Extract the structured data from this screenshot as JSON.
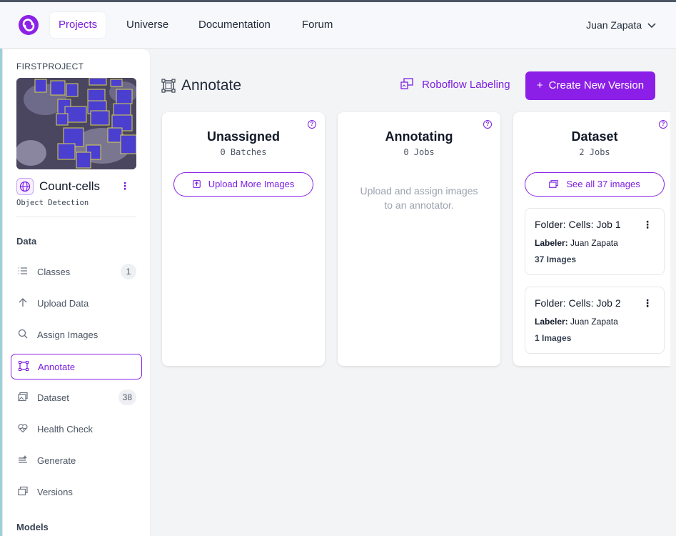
{
  "nav": {
    "items": [
      {
        "label": "Projects",
        "active": true
      },
      {
        "label": "Universe"
      },
      {
        "label": "Documentation"
      },
      {
        "label": "Forum"
      }
    ],
    "user": "Juan Zapata"
  },
  "sidebar": {
    "workspace": "FIRSTPROJECT",
    "project_name": "Count-cells",
    "project_type": "Object Detection",
    "sections": {
      "data": "Data",
      "models": "Models"
    },
    "items": [
      {
        "label": "Classes",
        "icon": "list-icon",
        "badge": "1"
      },
      {
        "label": "Upload Data",
        "icon": "arrow-up-icon"
      },
      {
        "label": "Assign Images",
        "icon": "search-icon"
      },
      {
        "label": "Annotate",
        "icon": "annotate-icon",
        "active": true
      },
      {
        "label": "Dataset",
        "icon": "images-icon",
        "badge": "38"
      },
      {
        "label": "Health Check",
        "icon": "heart-pulse-icon"
      },
      {
        "label": "Generate",
        "icon": "generate-icon"
      },
      {
        "label": "Versions",
        "icon": "versions-icon"
      }
    ]
  },
  "main": {
    "title": "Annotate",
    "roboflow_labeling": "Roboflow Labeling",
    "create_version": "Create New Version",
    "columns": {
      "unassigned": {
        "title": "Unassigned",
        "sub": "0 Batches",
        "button": "Upload More Images"
      },
      "annotating": {
        "title": "Annotating",
        "sub": "0 Jobs",
        "empty": "Upload and assign images to an annotator."
      },
      "dataset": {
        "title": "Dataset",
        "sub": "2 Jobs",
        "button": "See all 37 images",
        "jobs": [
          {
            "title": "Folder: Cells: Job 1",
            "labeler_label": "Labeler:",
            "labeler": "Juan Zapata",
            "count": "37 Images"
          },
          {
            "title": "Folder: Cells: Job 2",
            "labeler_label": "Labeler:",
            "labeler": "Juan Zapata",
            "count": "1 Images"
          }
        ]
      }
    }
  },
  "colors": {
    "accent": "#8b1fe8",
    "accent_text": "#7c1fe0"
  }
}
